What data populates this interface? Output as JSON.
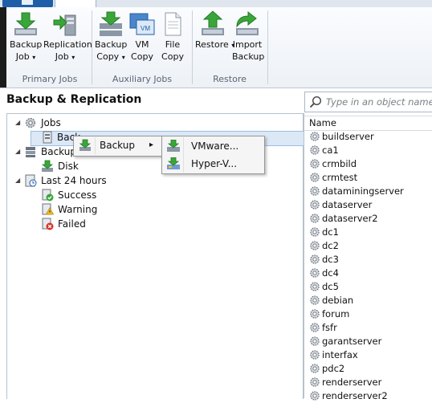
{
  "ribbon": {
    "groups": [
      {
        "label": "Primary Jobs"
      },
      {
        "label": "Auxiliary Jobs"
      },
      {
        "label": "Restore"
      }
    ],
    "buttons": {
      "backup_job": [
        "Backup",
        "Job"
      ],
      "replication_job": [
        "Replication",
        "Job"
      ],
      "backup_copy": [
        "Backup",
        "Copy"
      ],
      "vm_copy": [
        "VM",
        "Copy"
      ],
      "file_copy": [
        "File",
        "Copy"
      ],
      "restore": [
        "Restore"
      ],
      "import_backup": [
        "Import",
        "Backup"
      ],
      "dropdown_caret": "▾",
      "vm_badge": "VM"
    }
  },
  "left_pane": {
    "title": "Backup & Replication",
    "tree": {
      "jobs": "Jobs",
      "backup_job_item": "Back",
      "backups": "Backup",
      "disk": "Disk",
      "last24": "Last 24 hours",
      "success": "Success",
      "warning": "Warning",
      "failed": "Failed"
    }
  },
  "search": {
    "placeholder": "Type in an object name to"
  },
  "object_list": {
    "header": "Name",
    "items": [
      "buildserver",
      "ca1",
      "crmbild",
      "crmtest",
      "dataminingserver",
      "dataserver",
      "dataserver2",
      "dc1",
      "dc2",
      "dc3",
      "dc4",
      "dc5",
      "debian",
      "forum",
      "fsfr",
      "garantserver",
      "interfax",
      "pdc2",
      "renderserver",
      "renderserver2"
    ]
  },
  "context_menu": {
    "items": [
      {
        "label": "Backup",
        "arrow": "▸"
      }
    ],
    "submenu": [
      {
        "label": "VMware..."
      },
      {
        "label": "Hyper-V..."
      }
    ]
  },
  "colors": {
    "accent": "#1f5fa8",
    "selection": "#dbe8f6",
    "icon_green": "#3aa63a"
  }
}
